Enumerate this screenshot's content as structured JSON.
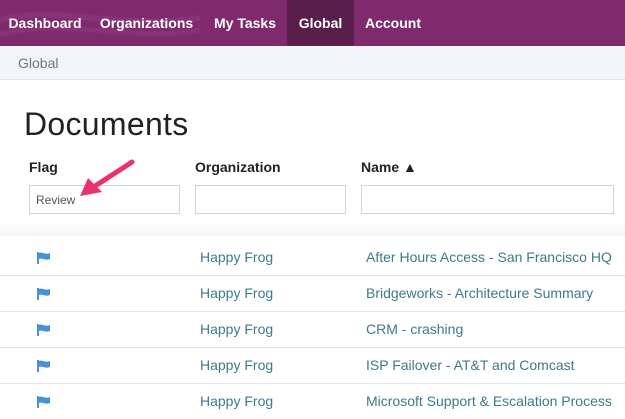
{
  "nav": {
    "items": [
      {
        "label": "Dashboard",
        "active": false
      },
      {
        "label": "Organizations",
        "active": false
      },
      {
        "label": "My Tasks",
        "active": false
      },
      {
        "label": "Global",
        "active": true
      },
      {
        "label": "Account",
        "active": false
      }
    ],
    "bar_color": "#7f2a6c",
    "active_color": "#5a1e4d"
  },
  "breadcrumb": "Global",
  "page_title": "Documents",
  "columns": {
    "flag": "Flag",
    "organization": "Organization",
    "name": "Name ▲"
  },
  "filters": {
    "flag_value": "Review",
    "organization_value": "",
    "name_value": ""
  },
  "rows": [
    {
      "flag_icon": "flag-icon",
      "organization": "Happy Frog",
      "name": "After Hours Access - San Francisco HQ"
    },
    {
      "flag_icon": "flag-icon",
      "organization": "Happy Frog",
      "name": "Bridgeworks - Architecture Summary"
    },
    {
      "flag_icon": "flag-icon",
      "organization": "Happy Frog",
      "name": "CRM - crashing"
    },
    {
      "flag_icon": "flag-icon",
      "organization": "Happy Frog",
      "name": "ISP Failover - AT&T and Comcast"
    },
    {
      "flag_icon": "flag-icon",
      "organization": "Happy Frog",
      "name": "Microsoft Support & Escalation Process"
    }
  ],
  "link_color": "#3d7a8a",
  "flag_color": "#4a90d9",
  "annotation": {
    "icon": "pink-arrow-annotation",
    "color": "#e8336d"
  }
}
